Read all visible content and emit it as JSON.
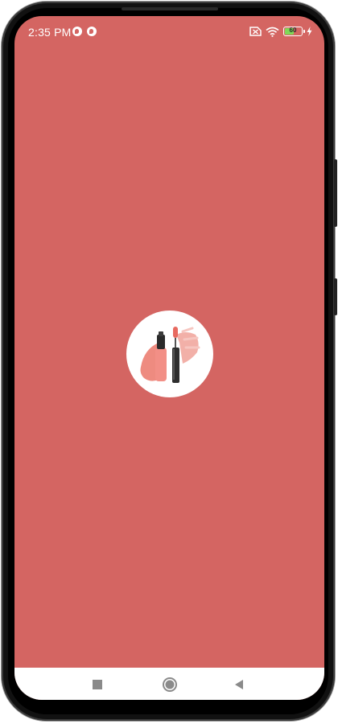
{
  "status_bar": {
    "time": "2:35 PM",
    "notification_icons": [
      "app-notification-icon",
      "app-notification-icon"
    ],
    "right_icons": [
      "no-sim-icon",
      "wifi-icon",
      "battery-icon",
      "charging-icon"
    ],
    "battery_percent": "60",
    "battery_level": 0.6
  },
  "splash": {
    "background_color": "#d46562",
    "logo_icon": "lip-gloss-logo-icon",
    "logo_background": "#ffffff"
  },
  "navigation_bar": {
    "buttons": [
      "recent-apps-button",
      "home-button",
      "back-button"
    ]
  },
  "colors": {
    "accent": "#d46562",
    "battery_fill": "#7ed957",
    "nav_icon": "#8a8a8a"
  }
}
